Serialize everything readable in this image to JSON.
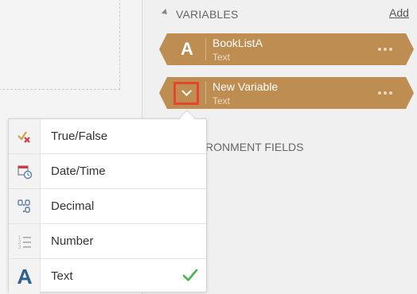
{
  "variables_panel": {
    "header": "VARIABLES",
    "add_label": "Add",
    "variables": [
      {
        "name": "BookListA",
        "type": "Text",
        "badge": "A"
      },
      {
        "name": "New Variable",
        "type": "Text"
      }
    ],
    "environment_header": "RONMENT FIELDS"
  },
  "type_dropdown": {
    "items": [
      {
        "label": "True/False",
        "icon": "true-false-icon"
      },
      {
        "label": "Date/Time",
        "icon": "calendar-clock-icon"
      },
      {
        "label": "Decimal",
        "icon": "decimal-icon"
      },
      {
        "label": "Number",
        "icon": "numbered-list-icon"
      },
      {
        "label": "Text",
        "icon": "text-type-icon",
        "selected": true
      }
    ]
  },
  "colors": {
    "card": "#bd8d52",
    "highlight": "#e5452f",
    "check": "#4caf50",
    "text_icon": "#2e6190"
  }
}
